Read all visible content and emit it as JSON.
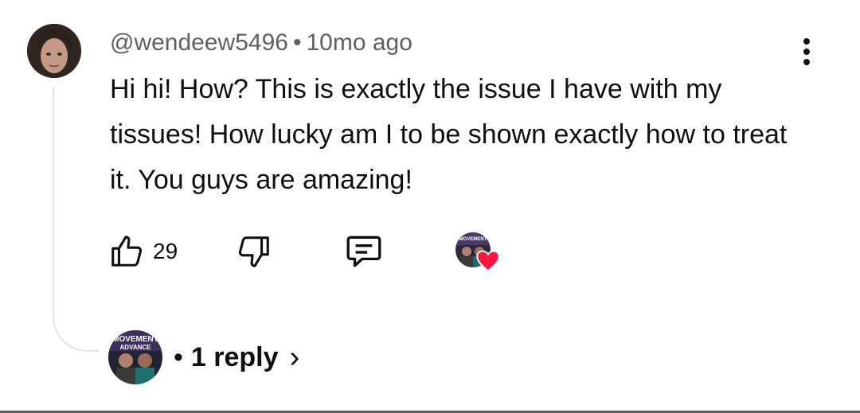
{
  "comment": {
    "author": "@wendeew5496",
    "separator": "•",
    "age": "10mo ago",
    "text": "Hi hi! How? This is exactly the issue I have with my tissues! How lucky am I to be shown exactly how to treat it. You guys are amazing!",
    "like_count": "29"
  },
  "icons": {
    "like": "thumbs-up-icon",
    "dislike": "thumbs-down-icon",
    "reply": "comment-icon",
    "menu": "more-vert-icon",
    "creator_heart": "heart-icon"
  },
  "replies": {
    "separator": "•",
    "label": "1 reply",
    "chevron": "›"
  },
  "creator_avatar_text": [
    "MOVEMENT",
    "ADVANCE"
  ],
  "colors": {
    "heart": "#ff1744",
    "meta_text": "#606060",
    "thread_line": "#e5e5e5"
  }
}
